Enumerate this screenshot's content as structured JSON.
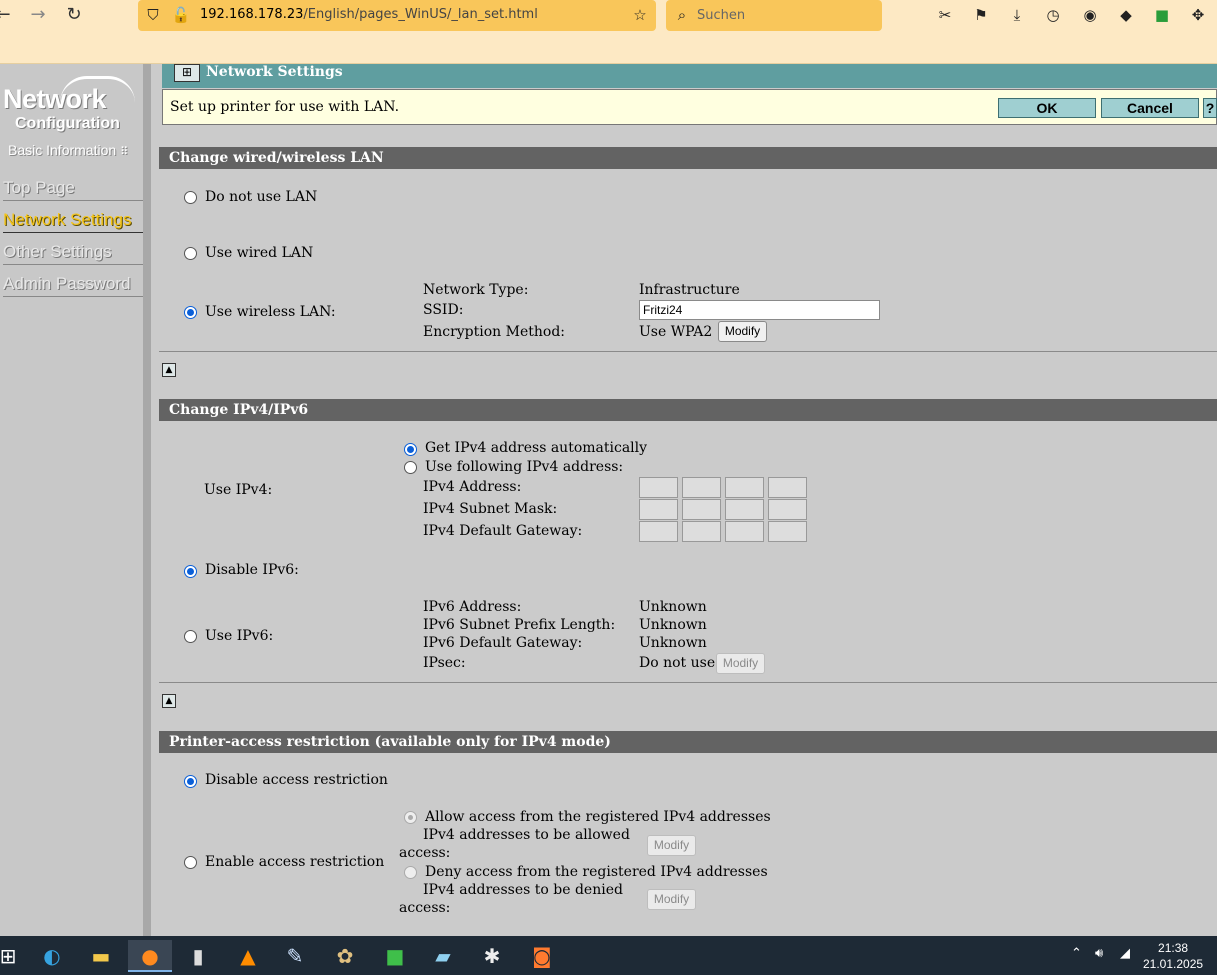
{
  "browser": {
    "url_host": "192.168.178.23",
    "url_path": "/English/pages_WinUS/_lan_set.html",
    "search_placeholder": "Suchen"
  },
  "sidebar": {
    "logo_line1": "Network",
    "logo_line2": "Configuration",
    "basic_info": "Basic Information",
    "items": [
      {
        "label": "Top Page"
      },
      {
        "label": "Network Settings"
      },
      {
        "label": "Other Settings"
      },
      {
        "label": "Admin Password"
      }
    ]
  },
  "header": {
    "title": "Network Settings",
    "subtitle": "Set up printer for use with LAN.",
    "ok_label": "OK",
    "cancel_label": "Cancel",
    "help_label": "?"
  },
  "lan": {
    "heading": "Change wired/wireless LAN",
    "opt_none": "Do not use LAN",
    "opt_wired": "Use wired LAN",
    "opt_wireless": "Use wireless LAN:",
    "network_type_label": "Network Type:",
    "network_type_value": "Infrastructure",
    "ssid_label": "SSID:",
    "ssid_value": "Fritzi24",
    "encryption_label": "Encryption Method:",
    "encryption_value": "Use WPA2",
    "modify_label": "Modify"
  },
  "ip": {
    "heading": "Change IPv4/IPv6",
    "use_ipv4_label": "Use IPv4:",
    "auto_label": "Get IPv4 address automatically",
    "manual_label": "Use following IPv4 address:",
    "address_label": "IPv4 Address:",
    "subnet_label": "IPv4 Subnet Mask:",
    "gateway_label": "IPv4 Default Gateway:",
    "disable_ipv6_label": "Disable IPv6:",
    "use_ipv6_label": "Use IPv6:",
    "ipv6_address_label": "IPv6 Address:",
    "ipv6_address_value": "Unknown",
    "ipv6_prefix_label": "IPv6 Subnet Prefix Length:",
    "ipv6_prefix_value": "Unknown",
    "ipv6_gateway_label": "IPv6 Default Gateway:",
    "ipv6_gateway_value": "Unknown",
    "ipsec_label": "IPsec:",
    "ipsec_value": "Do not use",
    "modify_label": "Modify"
  },
  "access": {
    "heading": "Printer-access restriction (available only for IPv4 mode)",
    "disable_label": "Disable access restriction",
    "enable_label": "Enable access restriction",
    "allow_label": "Allow access from the registered IPv4 addresses",
    "allowed_line1": "IPv4 addresses to be allowed",
    "allowed_line2": "access:",
    "deny_label": "Deny access from the registered IPv4 addresses",
    "denied_line1": "IPv4 addresses to be denied",
    "denied_line2": "access:",
    "modify_label": "Modify"
  },
  "taskbar": {
    "time": "21:38",
    "date": "21.01.2025"
  },
  "colors": {
    "accent_teal": "#5f9ea0",
    "section_header": "#636363",
    "active_nav": "#f5c518",
    "radio_selected": "#0a5fd8"
  }
}
